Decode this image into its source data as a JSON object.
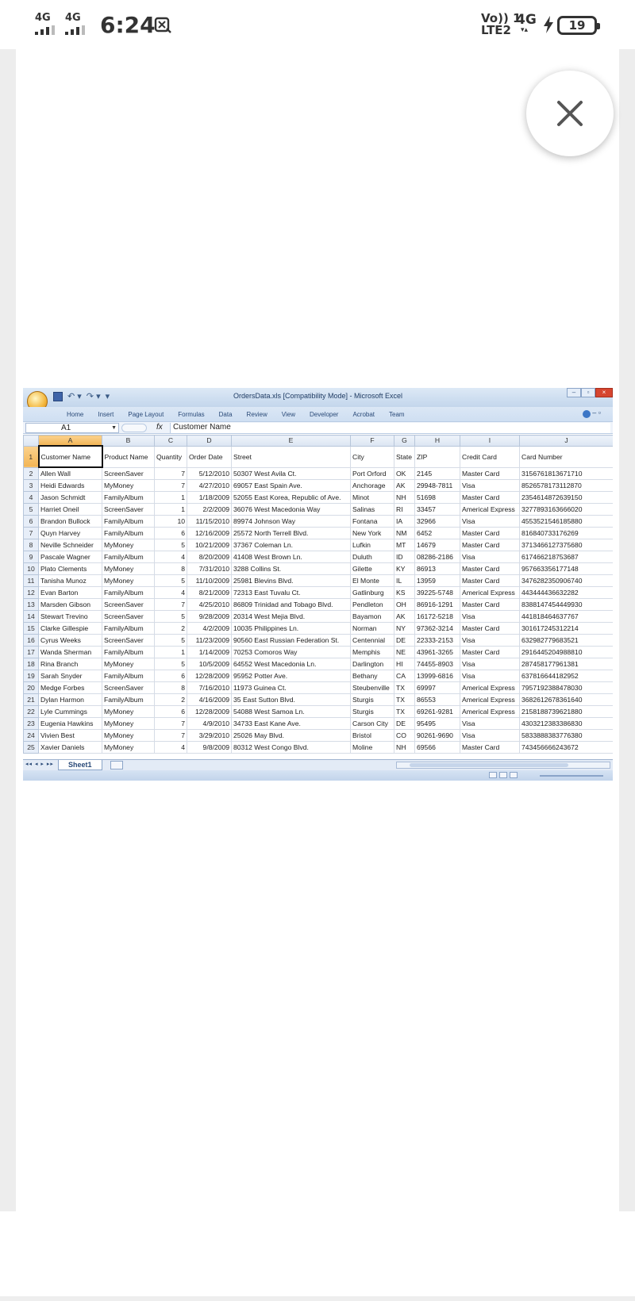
{
  "status_bar": {
    "sim1_network": "4G",
    "sim2_network": "4G",
    "time": "6:24",
    "volte_line1": "Vo)) 1",
    "volte_line2": "LTE2",
    "network_right": "4G",
    "battery_level": "19"
  },
  "viewer": {
    "close_icon": "close-icon"
  },
  "excel": {
    "window_title": "OrdersData.xls [Compatibility Mode] - Microsoft Excel",
    "ribbon_tabs": [
      "Home",
      "Insert",
      "Page Layout",
      "Formulas",
      "Data",
      "Review",
      "View",
      "Developer",
      "Acrobat",
      "Team"
    ],
    "name_box": "A1",
    "fx_label": "fx",
    "formula_value": "Customer Name",
    "column_letters": [
      "A",
      "B",
      "C",
      "D",
      "E",
      "F",
      "G",
      "H",
      "I",
      "J"
    ],
    "headers": [
      "Customer Name",
      "Product Name",
      "Quantity",
      "Order Date",
      "Street",
      "City",
      "State",
      "ZIP",
      "Credit Card",
      "Card Number"
    ],
    "rows": [
      [
        "2",
        "Allen Wall",
        "ScreenSaver",
        "7",
        "5/12/2010",
        "50307 West Avila Ct.",
        "Port Orford",
        "OK",
        "2145",
        "Master Card",
        "3156761813671710"
      ],
      [
        "3",
        "Heidi Edwards",
        "MyMoney",
        "7",
        "4/27/2010",
        "69057 East Spain Ave.",
        "Anchorage",
        "AK",
        "29948-7811",
        "Visa",
        "8526578173112870"
      ],
      [
        "4",
        "Jason Schmidt",
        "FamilyAlbum",
        "1",
        "1/18/2009",
        "52055 East Korea, Republic of Ave.",
        "Minot",
        "NH",
        "51698",
        "Master Card",
        "2354614872639150"
      ],
      [
        "5",
        "Harriet Oneil",
        "ScreenSaver",
        "1",
        "2/2/2009",
        "36076 West Macedonia Way",
        "Salinas",
        "RI",
        "33457",
        "Americal Express",
        "3277893163666020"
      ],
      [
        "6",
        "Brandon Bullock",
        "FamilyAlbum",
        "10",
        "11/15/2010",
        "89974 Johnson Way",
        "Fontana",
        "IA",
        "32966",
        "Visa",
        "4553521546185880"
      ],
      [
        "7",
        "Quyn Harvey",
        "FamilyAlbum",
        "6",
        "12/16/2009",
        "25572 North Terrell Blvd.",
        "New York",
        "NM",
        "6452",
        "Master Card",
        "816840733176269"
      ],
      [
        "8",
        "Neville Schneider",
        "MyMoney",
        "5",
        "10/21/2009",
        "37367 Coleman Ln.",
        "Lufkin",
        "MT",
        "14679",
        "Master Card",
        "3713466127375680"
      ],
      [
        "9",
        "Pascale Wagner",
        "FamilyAlbum",
        "4",
        "8/20/2009",
        "41408 West Brown Ln.",
        "Duluth",
        "ID",
        "08286-2186",
        "Visa",
        "617466218753687"
      ],
      [
        "10",
        "Plato Clements",
        "MyMoney",
        "8",
        "7/31/2010",
        "3288 Collins St.",
        "Gilette",
        "KY",
        "86913",
        "Master Card",
        "957663356177148"
      ],
      [
        "11",
        "Tanisha Munoz",
        "MyMoney",
        "5",
        "11/10/2009",
        "25981 Blevins Blvd.",
        "El Monte",
        "IL",
        "13959",
        "Master Card",
        "3476282350906740"
      ],
      [
        "12",
        "Evan Barton",
        "FamilyAlbum",
        "4",
        "8/21/2009",
        "72313 East Tuvalu Ct.",
        "Gatlinburg",
        "KS",
        "39225-5748",
        "Americal Express",
        "443444436632282"
      ],
      [
        "13",
        "Marsden Gibson",
        "ScreenSaver",
        "7",
        "4/25/2010",
        "86809 Trinidad and Tobago Blvd.",
        "Pendleton",
        "OH",
        "86916-1291",
        "Master Card",
        "8388147454449930"
      ],
      [
        "14",
        "Stewart Trevino",
        "ScreenSaver",
        "5",
        "9/28/2009",
        "20314 West Mejia Blvd.",
        "Bayamon",
        "AK",
        "16172-5218",
        "Visa",
        "441818464637767"
      ],
      [
        "15",
        "Clarke Gillespie",
        "FamilyAlbum",
        "2",
        "4/2/2009",
        "10035 Philippines Ln.",
        "Norman",
        "NY",
        "97362-3214",
        "Master Card",
        "301617245312214"
      ],
      [
        "16",
        "Cyrus Weeks",
        "ScreenSaver",
        "5",
        "11/23/2009",
        "90560 East Russian Federation St.",
        "Centennial",
        "DE",
        "22333-2153",
        "Visa",
        "632982779683521"
      ],
      [
        "17",
        "Wanda Sherman",
        "FamilyAlbum",
        "1",
        "1/14/2009",
        "70253 Comoros Way",
        "Memphis",
        "NE",
        "43961-3265",
        "Master Card",
        "2916445204988810"
      ],
      [
        "18",
        "Rina Branch",
        "MyMoney",
        "5",
        "10/5/2009",
        "64552 West Macedonia Ln.",
        "Darlington",
        "HI",
        "74455-8903",
        "Visa",
        "287458177961381"
      ],
      [
        "19",
        "Sarah Snyder",
        "FamilyAlbum",
        "6",
        "12/28/2009",
        "95952 Potter Ave.",
        "Bethany",
        "CA",
        "13999-6816",
        "Visa",
        "637816644182952"
      ],
      [
        "20",
        "Medge Forbes",
        "ScreenSaver",
        "8",
        "7/16/2010",
        "11973 Guinea Ct.",
        "Steubenville",
        "TX",
        "69997",
        "Americal Express",
        "7957192388478030"
      ],
      [
        "21",
        "Dylan Harmon",
        "FamilyAlbum",
        "2",
        "4/16/2009",
        "35 East Sutton Blvd.",
        "Sturgis",
        "TX",
        "86553",
        "Americal Express",
        "3682612678361640"
      ],
      [
        "22",
        "Lyle Cummings",
        "MyMoney",
        "6",
        "12/28/2009",
        "54088 West Samoa Ln.",
        "Sturgis",
        "TX",
        "69261-9281",
        "Americal Express",
        "2158188739621880"
      ],
      [
        "23",
        "Eugenia Hawkins",
        "MyMoney",
        "7",
        "4/9/2010",
        "34733 East Kane Ave.",
        "Carson City",
        "DE",
        "95495",
        "Visa",
        "4303212383386830"
      ],
      [
        "24",
        "Vivien Best",
        "MyMoney",
        "7",
        "3/29/2010",
        "25026 May Blvd.",
        "Bristol",
        "CO",
        "90261-9690",
        "Visa",
        "5833888383776380"
      ],
      [
        "25",
        "Xavier Daniels",
        "MyMoney",
        "4",
        "9/8/2009",
        "80312 West Congo Blvd.",
        "Moline",
        "NH",
        "69566",
        "Master Card",
        "743456666243672"
      ]
    ],
    "sheet_tab": "Sheet1"
  }
}
